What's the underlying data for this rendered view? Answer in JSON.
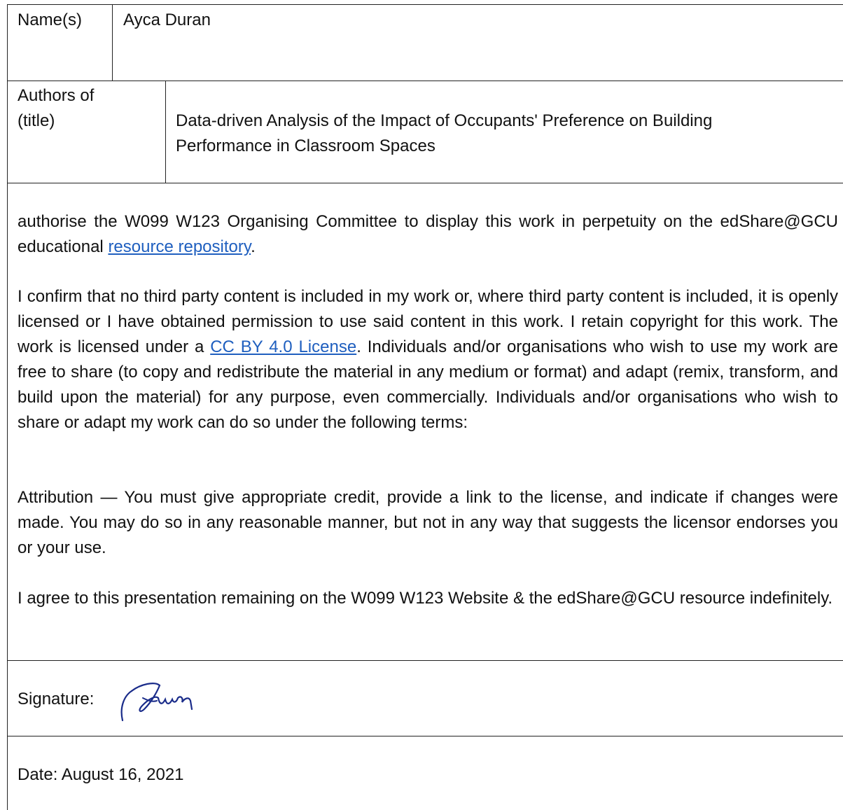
{
  "names": {
    "label": "Name(s)",
    "value": "Ayca Duran"
  },
  "authors": {
    "label_line1": "Authors of",
    "label_line2": "(title)",
    "title_line1": "Data-driven Analysis of the Impact of Occupants' Preference on Building",
    "title_line2": "Performance in Classroom Spaces"
  },
  "authorisation": {
    "p1_text": "authorise the W099 W123 Organising Committee to display this work in perpetuity on the edShare@GCU educational ",
    "p1_link": "resource repository",
    "p1_end": ".",
    "p2_text": "I confirm that no third party content is included in my work or, where third party content is included, it is openly licensed or I have obtained permission to use said content in this work. I retain copyright for this work. The work is licensed under a ",
    "p2_link": "CC BY 4.0 License",
    "p2_end": ". Individuals and/or organisations who wish to use my work are free to share (to copy and redistribute the material in any medium or format) and adapt (remix, transform, and build upon the material) for any purpose, even commercially. Individuals and/or organisations who wish to share or adapt my work can do so under the following terms:",
    "p3": "Attribution — You must give appropriate credit, provide a link to the license, and indicate if changes were made. You may do so in any reasonable manner, but not in any way that suggests the licensor endorses you or your use.",
    "p4": "I agree to this presentation remaining on the W099 W123 Website & the edShare@GCU resource indefinitely."
  },
  "signature": {
    "label": "Signature:"
  },
  "date": {
    "text": "Date: August 16, 2021"
  }
}
